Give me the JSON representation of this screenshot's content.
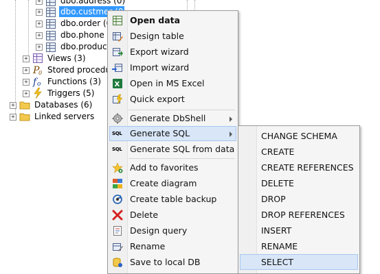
{
  "tree": {
    "tables": [
      {
        "label": "dbo.address (0)",
        "selected": false
      },
      {
        "label": "dbo.custmer (0",
        "selected": true
      },
      {
        "label": "dbo.order (0)",
        "selected": false
      },
      {
        "label": "dbo.phone (",
        "selected": false
      },
      {
        "label": "dbo.product",
        "selected": false
      }
    ],
    "folders": [
      {
        "label": "Views (3)",
        "icon": "views-icon"
      },
      {
        "label": "Stored procedur",
        "icon": "stored-procedure-icon"
      },
      {
        "label": "Functions (3)",
        "icon": "function-icon"
      },
      {
        "label": "Triggers (5)",
        "icon": "trigger-icon"
      }
    ],
    "root": [
      {
        "label": "Databases (6)",
        "icon": "folder-icon"
      },
      {
        "label": "Linked servers",
        "icon": "folder-icon"
      }
    ]
  },
  "context_menu": {
    "items": [
      {
        "label": "Open data",
        "icon": "grid-icon"
      },
      {
        "label": "Design table",
        "icon": "design-table-icon"
      },
      {
        "label": "Export wizard",
        "icon": "export-icon"
      },
      {
        "label": "Import wizard",
        "icon": "import-icon"
      },
      {
        "label": "Open in MS Excel",
        "icon": "excel-icon"
      },
      {
        "label": "Quick export",
        "icon": "quick-export-icon"
      },
      {
        "label": "Generate DbShell",
        "icon": "gear-icon"
      },
      {
        "label": "Generate SQL",
        "icon": "sql-icon"
      },
      {
        "label": "Generate SQL from data",
        "icon": "sql-data-icon"
      },
      {
        "label": "Add to favorites",
        "icon": "star-icon"
      },
      {
        "label": "Create diagram",
        "icon": "diagram-icon"
      },
      {
        "label": "Create table backup",
        "icon": "backup-icon"
      },
      {
        "label": "Delete",
        "icon": "delete-icon"
      },
      {
        "label": "Design query",
        "icon": "query-icon"
      },
      {
        "label": "Rename",
        "icon": "rename-icon"
      },
      {
        "label": "Save to local DB",
        "icon": "save-local-icon"
      }
    ]
  },
  "submenu": {
    "items": [
      {
        "label": "CHANGE SCHEMA"
      },
      {
        "label": "CREATE"
      },
      {
        "label": "CREATE REFERENCES"
      },
      {
        "label": "DELETE"
      },
      {
        "label": "DROP"
      },
      {
        "label": "DROP REFERENCES"
      },
      {
        "label": "INSERT"
      },
      {
        "label": "RENAME"
      },
      {
        "label": "SELECT"
      }
    ]
  },
  "colors": {
    "selection": "#3399ff",
    "menu_highlight": "#d8e6f8",
    "menu_highlight_border": "#a8c6ee",
    "menu_background": "#f5f5f5"
  }
}
